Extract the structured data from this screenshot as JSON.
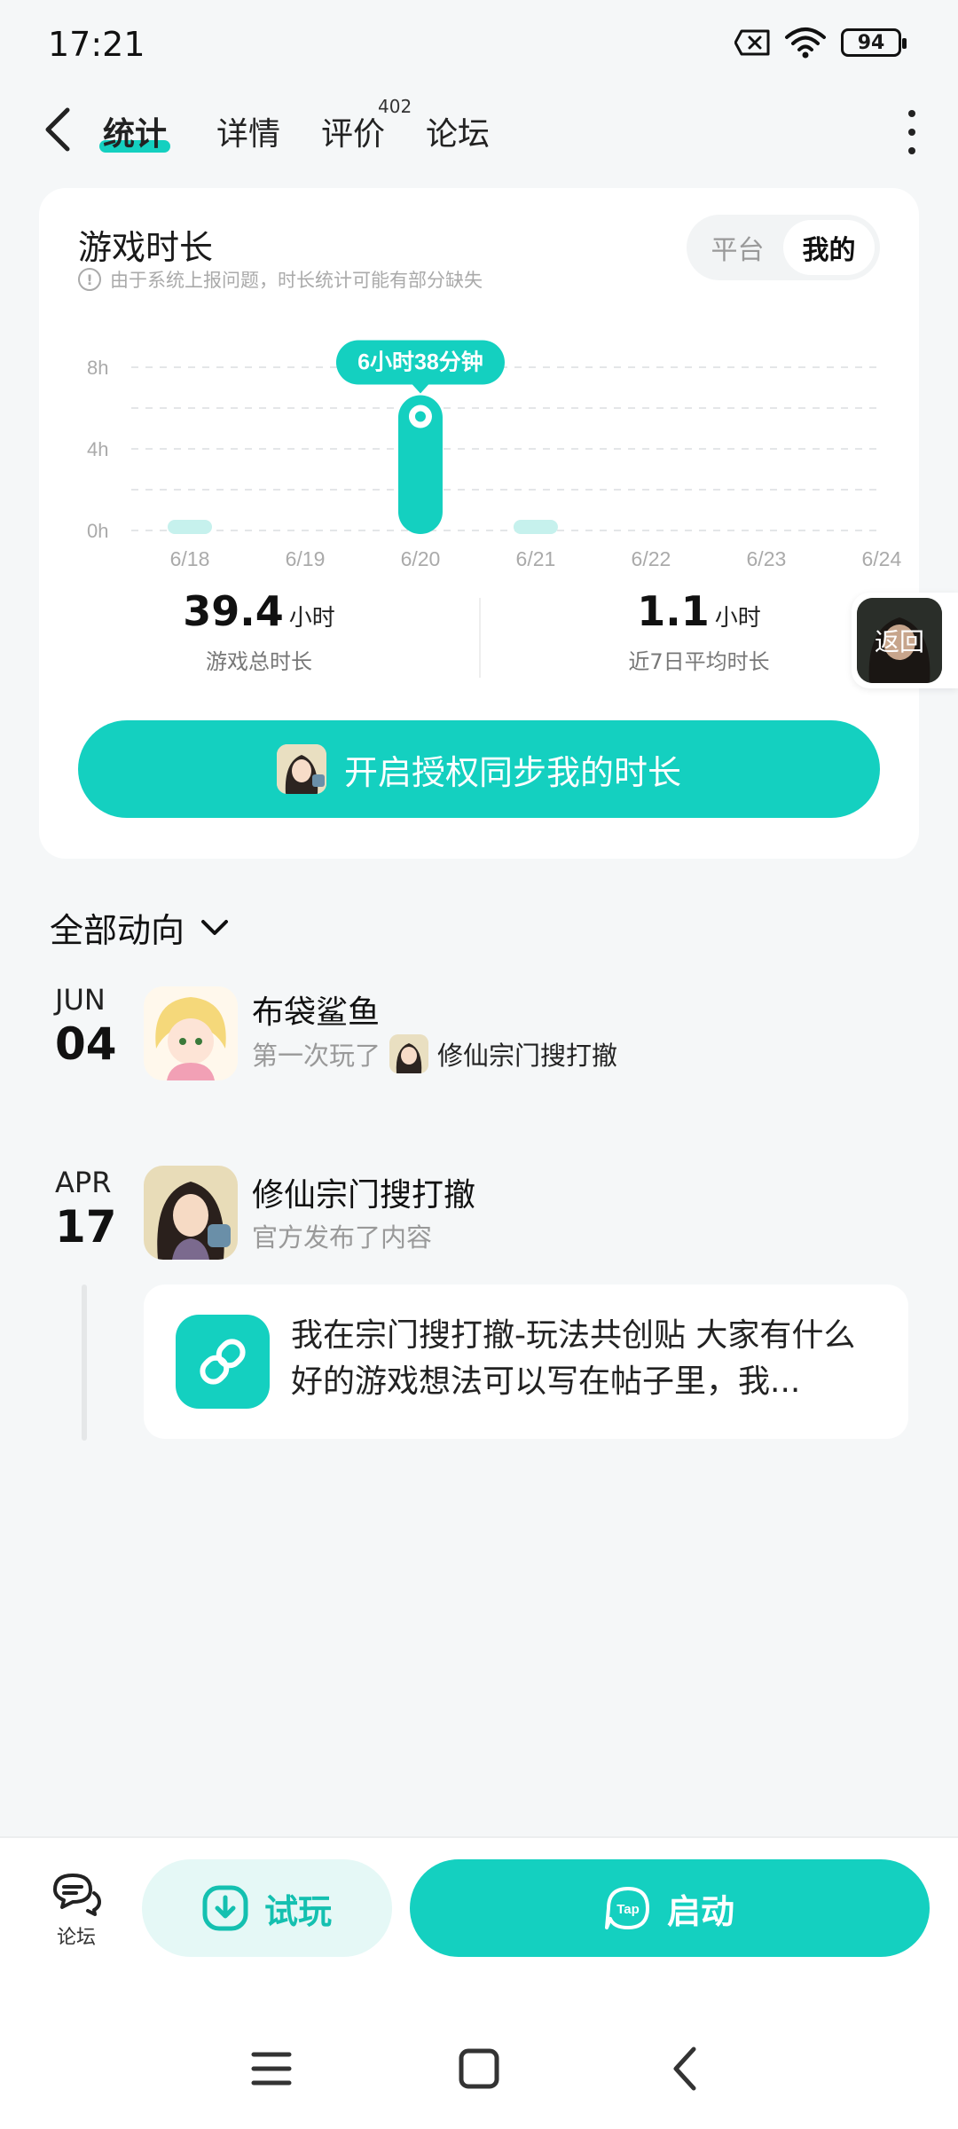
{
  "status_bar": {
    "time": "17:21",
    "battery": "94"
  },
  "nav": {
    "tabs": [
      {
        "label": "统计"
      },
      {
        "label": "详情"
      },
      {
        "label": "评价",
        "badge": "402"
      },
      {
        "label": "论坛"
      }
    ]
  },
  "stats": {
    "title": "游戏时长",
    "notice": "由于系统上报问题，时长统计可能有部分缺失",
    "toggle": [
      "平台",
      "我的"
    ],
    "total_value": "39.4",
    "total_unit": "小时",
    "total_label": "游戏总时长",
    "avg_value": "1.1",
    "avg_unit": "小时",
    "avg_label": "近7日平均时长",
    "auth_button": "开启授权同步我的时长"
  },
  "chart_data": {
    "type": "bar",
    "categories": [
      "6/18",
      "6/19",
      "6/20",
      "6/21",
      "6/22",
      "6/23",
      "6/24"
    ],
    "values": [
      0.2,
      0,
      6.63,
      0.2,
      0,
      0,
      0
    ],
    "y_ticks": [
      "0h",
      "4h",
      "8h"
    ],
    "ylim": [
      0,
      8
    ],
    "highlight_label": "6小时38分钟",
    "highlight_index": 2,
    "colors": {
      "bar": "#14d0c0",
      "bar_faint": "#c6f1ed"
    }
  },
  "float_return": {
    "label": "返回"
  },
  "feed": {
    "filter_label": "全部动向",
    "items": [
      {
        "month": "JUN",
        "day": "04",
        "name": "布袋鲨鱼",
        "action": "第一次玩了",
        "game": "修仙宗门搜打撤"
      },
      {
        "month": "APR",
        "day": "17",
        "name": "修仙宗门搜打撤",
        "action": "官方发布了内容"
      }
    ],
    "post_text": "我在宗门搜打撤-玩法共创贴 大家有什么好的游戏想法可以写在帖子里，我..."
  },
  "bottom": {
    "forum_label": "论坛",
    "trial_label": "试玩",
    "launch_label": "启动"
  }
}
